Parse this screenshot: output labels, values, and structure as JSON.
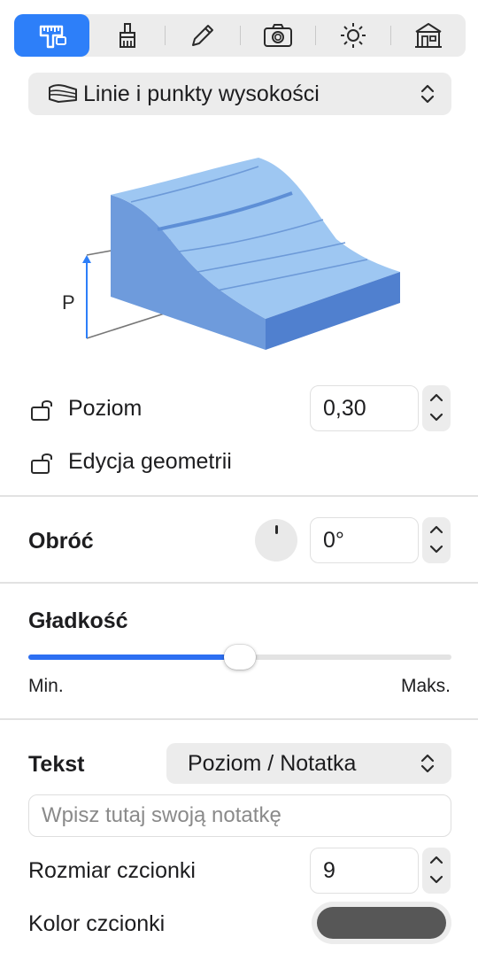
{
  "toolbar": {
    "tabs": [
      {
        "name": "measure-icon",
        "active": true
      },
      {
        "name": "brush-icon",
        "active": false
      },
      {
        "name": "pencil-icon",
        "active": false
      },
      {
        "name": "camera-icon",
        "active": false
      },
      {
        "name": "sun-icon",
        "active": false
      },
      {
        "name": "building-icon",
        "active": false
      }
    ]
  },
  "mode_select": {
    "label": "Linie i punkty wysokości",
    "icon": "terrain-layers-icon"
  },
  "illustration": {
    "label": "P"
  },
  "level": {
    "label": "Poziom",
    "value": "0,30"
  },
  "edit_geometry": {
    "label": "Edycja geometrii"
  },
  "rotate": {
    "label": "Obróć",
    "value": "0°"
  },
  "smoothness": {
    "label": "Gładkość",
    "min_label": "Min.",
    "max_label": "Maks.",
    "value_fraction": 0.5
  },
  "text_section": {
    "label": "Tekst",
    "popup_value": "Poziom / Notatka",
    "note_placeholder": "Wpisz tutaj swoją notatkę",
    "font_size_label": "Rozmiar czcionki",
    "font_size_value": "9",
    "font_color_label": "Kolor czcionki",
    "font_color": "#575757"
  },
  "colors": {
    "accent": "#2d7ff9",
    "slider_fill": "#2d6ff2",
    "terrain_top": "#9ec7f2",
    "terrain_side": "#5e90d6"
  }
}
